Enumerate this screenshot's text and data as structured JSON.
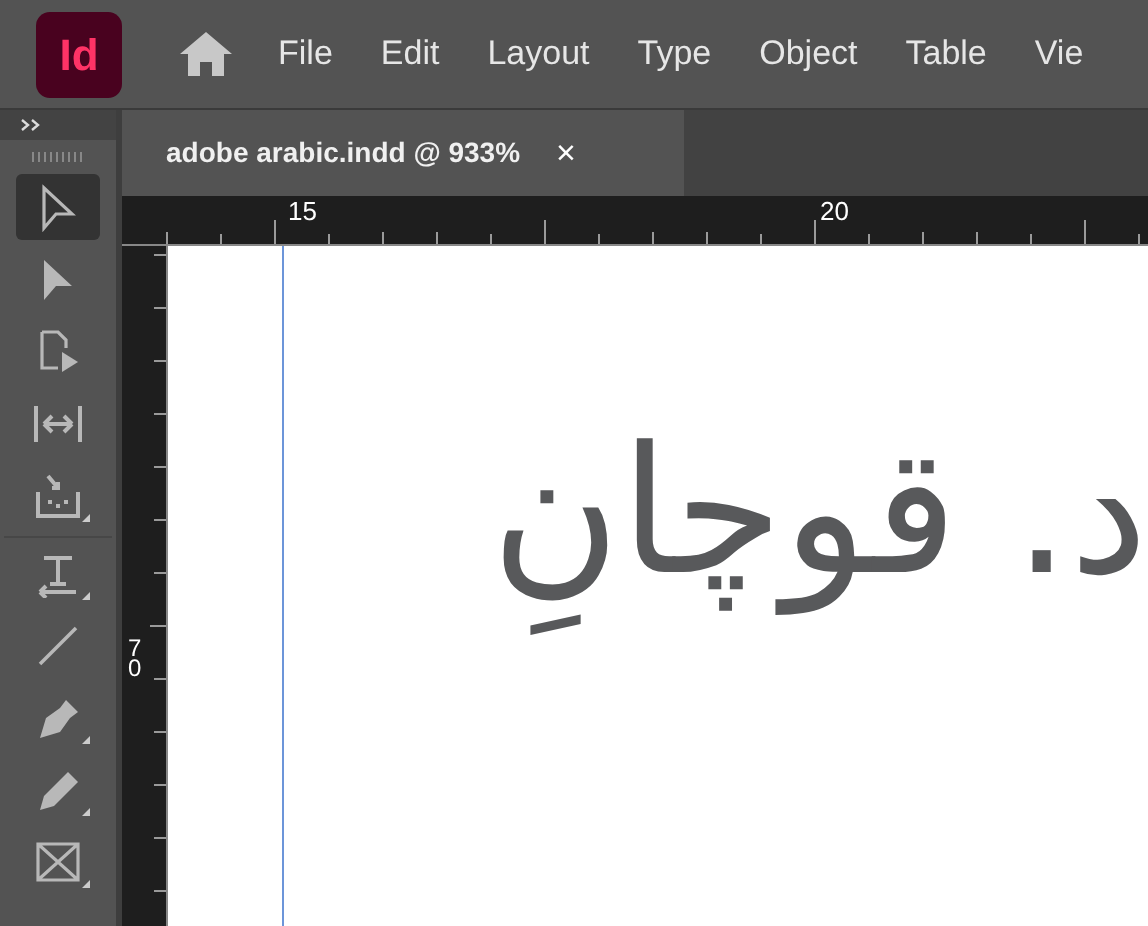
{
  "app": {
    "logo": "Id"
  },
  "menu": [
    "File",
    "Edit",
    "Layout",
    "Type",
    "Object",
    "Table",
    "Vie"
  ],
  "tools": [
    {
      "kind": "selection",
      "selected": true
    },
    {
      "kind": "direct",
      "selected": false
    },
    {
      "kind": "page",
      "selected": false
    },
    {
      "kind": "gap",
      "selected": false
    },
    {
      "kind": "collector",
      "selected": false
    },
    {
      "kind": "type",
      "selected": false
    },
    {
      "kind": "line",
      "selected": false
    },
    {
      "kind": "pen",
      "selected": false
    },
    {
      "kind": "pencil",
      "selected": false
    },
    {
      "kind": "frame",
      "selected": false
    }
  ],
  "tab": {
    "title": "adobe arabic.indd @ 933%",
    "close": "×"
  },
  "ruler": {
    "horizontal": [
      "15",
      "20"
    ],
    "vertical": [
      "7",
      "0"
    ]
  },
  "document": {
    "text": "د. قوچانِ"
  }
}
